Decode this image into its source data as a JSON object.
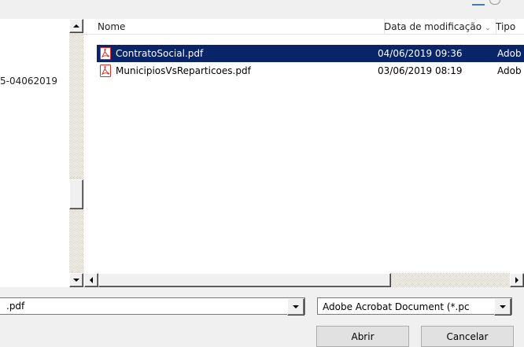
{
  "nav": {
    "partial_item": "5-04062019"
  },
  "file_list": {
    "columns": {
      "name": "Nome",
      "date": "Data de modificação",
      "type": "Tipo"
    },
    "rows": [
      {
        "name": "ContratoSocial.pdf",
        "date": "04/06/2019 09:36",
        "type": "Adob",
        "icon": "pdf-file-icon"
      },
      {
        "name": "MunicipiosVsReparticoes.pdf",
        "date": "03/06/2019 08:19",
        "type": "Adob",
        "icon": "pdf-file-icon"
      }
    ]
  },
  "filename": {
    "value": ".pdf"
  },
  "filetype": {
    "selected": "Adobe Acrobat Document (*.pc"
  },
  "buttons": {
    "open": "Abrir",
    "cancel": "Cancelar"
  },
  "colors": {
    "selection": "#0a246a",
    "pdf_icon": "#d32f2f"
  }
}
